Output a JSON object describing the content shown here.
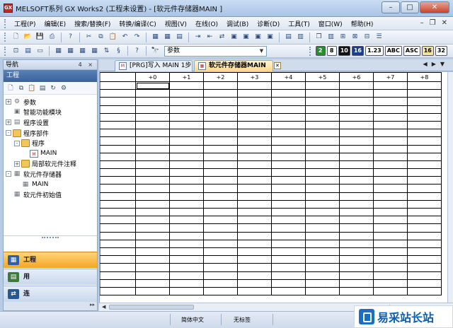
{
  "window": {
    "title": "MELSOFT系列 GX Works2 (工程未设置) - [软元件存储器MAIN ]",
    "icon_label": "GX"
  },
  "menu": {
    "items": [
      "工程(P)",
      "编辑(E)",
      "搜索/替换(F)",
      "转换/编译(C)",
      "视图(V)",
      "在线(O)",
      "调试(B)",
      "诊断(D)",
      "工具(T)",
      "窗口(W)",
      "帮助(H)"
    ]
  },
  "toolbar": {
    "device_combo_value": "参数",
    "format_pills": [
      "2",
      "8",
      "10",
      "16",
      "1.23",
      "ABC",
      "ASC",
      "16",
      "32"
    ]
  },
  "navigation": {
    "panel_title": "导航",
    "panel_controls": "4 × ",
    "section_title": "工程",
    "tree": [
      {
        "label": "参数",
        "level": 0,
        "expander": "+",
        "icon": "gear-icon"
      },
      {
        "label": "智能功能模块",
        "level": 0,
        "expander": "",
        "icon": "module-icon"
      },
      {
        "label": "程序设置",
        "level": 0,
        "expander": "+",
        "icon": "settings-icon"
      },
      {
        "label": "程序部件",
        "level": 0,
        "expander": "-",
        "icon": "folder-icon"
      },
      {
        "label": "程序",
        "level": 1,
        "expander": "-",
        "icon": "folder-icon"
      },
      {
        "label": "MAIN",
        "level": 2,
        "expander": "",
        "icon": "program-icon"
      },
      {
        "label": "局部软元件注释",
        "level": 1,
        "expander": "+",
        "icon": "folder-icon"
      },
      {
        "label": "软元件存储器",
        "level": 0,
        "expander": "-",
        "icon": "memory-icon"
      },
      {
        "label": "MAIN",
        "level": 1,
        "expander": "",
        "icon": "memory-icon"
      },
      {
        "label": "软元件初始值",
        "level": 0,
        "expander": "",
        "icon": "memory-icon"
      }
    ],
    "bottom_tabs": [
      {
        "label": "工程",
        "active": true
      },
      {
        "label": "用",
        "active": false
      },
      {
        "label": "连",
        "active": false
      }
    ]
  },
  "tabs": [
    {
      "label": "[PRG]写入 MAIN 1步",
      "active": false
    },
    {
      "label": "软元件存储器MAIN",
      "active": true
    }
  ],
  "grid": {
    "columns": [
      "+0",
      "+1",
      "+2",
      "+3",
      "+4",
      "+5",
      "+6",
      "+7",
      "+8"
    ],
    "row_count": 27
  },
  "status": {
    "language": "简体中文",
    "label_state": "无标签"
  },
  "watermark": {
    "text": "易采站长站"
  }
}
